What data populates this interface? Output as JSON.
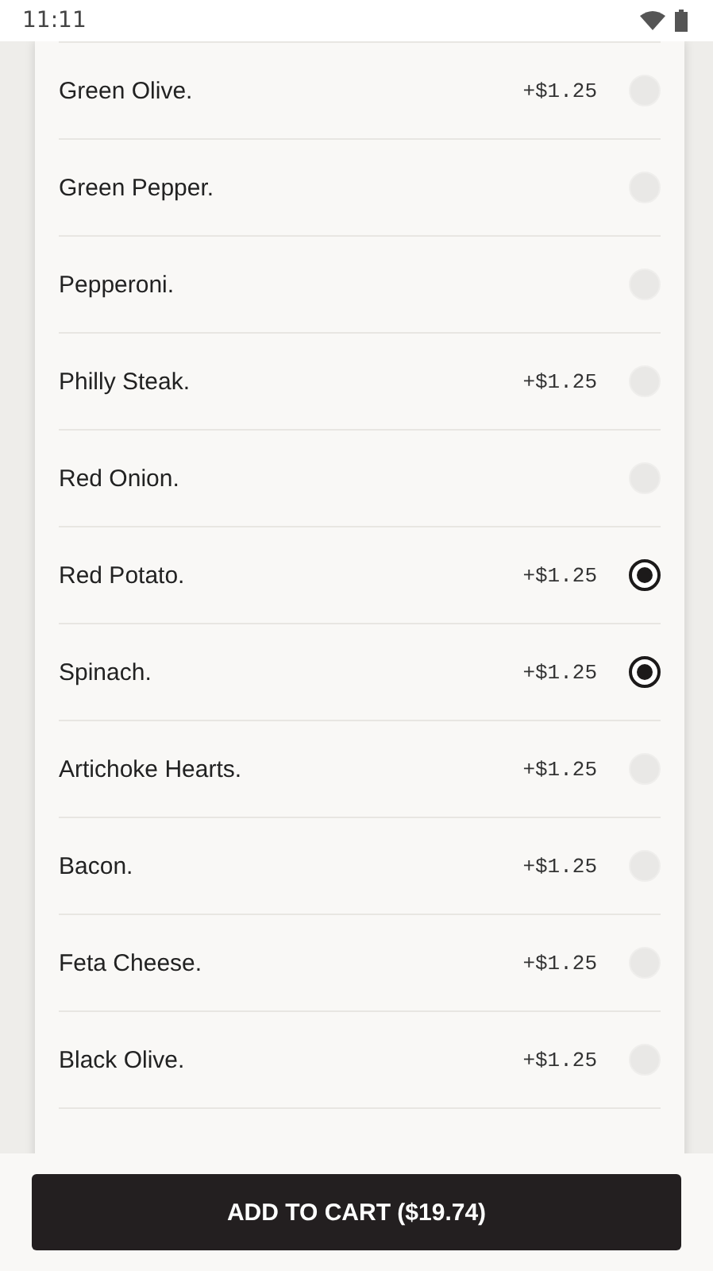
{
  "status_bar": {
    "time": "11:11"
  },
  "options": [
    {
      "name": "Green Olive.",
      "price": "+$1.25",
      "selected": false
    },
    {
      "name": "Green Pepper.",
      "selected": false
    },
    {
      "name": "Pepperoni.",
      "selected": false
    },
    {
      "name": "Philly Steak.",
      "price": "+$1.25",
      "selected": false
    },
    {
      "name": "Red Onion.",
      "selected": false
    },
    {
      "name": "Red Potato.",
      "price": "+$1.25",
      "selected": true
    },
    {
      "name": "Spinach.",
      "price": "+$1.25",
      "selected": true
    },
    {
      "name": "Artichoke Hearts.",
      "price": "+$1.25",
      "selected": false
    },
    {
      "name": "Bacon.",
      "price": "+$1.25",
      "selected": false
    },
    {
      "name": "Feta Cheese.",
      "price": "+$1.25",
      "selected": false
    },
    {
      "name": "Black Olive.",
      "price": "+$1.25",
      "selected": false
    }
  ],
  "add_button": "ADD TO CART ($19.74)"
}
